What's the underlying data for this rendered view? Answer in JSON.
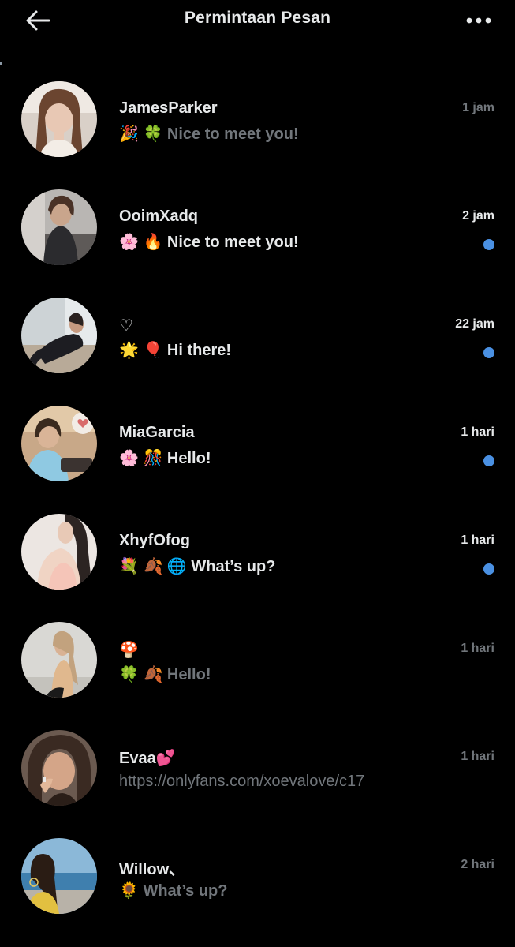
{
  "header": {
    "title": "Permintaan Pesan",
    "back_icon": "arrow-left-icon",
    "more_icon": "more-horizontal-icon"
  },
  "colors": {
    "background": "#000000",
    "primary_text": "#e7e9ea",
    "secondary_text": "#71767b",
    "unread_dot": "#4a90e2"
  },
  "messages": [
    {
      "name": "JamesParker",
      "preview": "🎉 🍀 Nice to meet you!",
      "time": "1 jam",
      "unread": false
    },
    {
      "name": "OoimXadq",
      "preview": "🌸 🔥 Nice to meet you!",
      "time": "2 jam",
      "unread": true
    },
    {
      "name": "♡",
      "preview": "🌟 🎈 Hi there!",
      "time": "22 jam",
      "unread": true
    },
    {
      "name": "MiaGarcia",
      "preview": "🌸 🎊 Hello!",
      "time": "1 hari",
      "unread": true
    },
    {
      "name": "XhyfOfog",
      "preview": "💐 🍂 🌐 What’s up?",
      "time": "1 hari",
      "unread": true
    },
    {
      "name": "🍄",
      "preview": "🍀 🍂 Hello!",
      "time": "1 hari",
      "unread": false
    },
    {
      "name": "Evaa💕",
      "preview": "https://onlyfans.com/xoevalove/c17",
      "time": "1 hari",
      "unread": false
    },
    {
      "name": "Willow、",
      "preview": "🌻 What’s up?",
      "time": "2 hari",
      "unread": false
    }
  ]
}
